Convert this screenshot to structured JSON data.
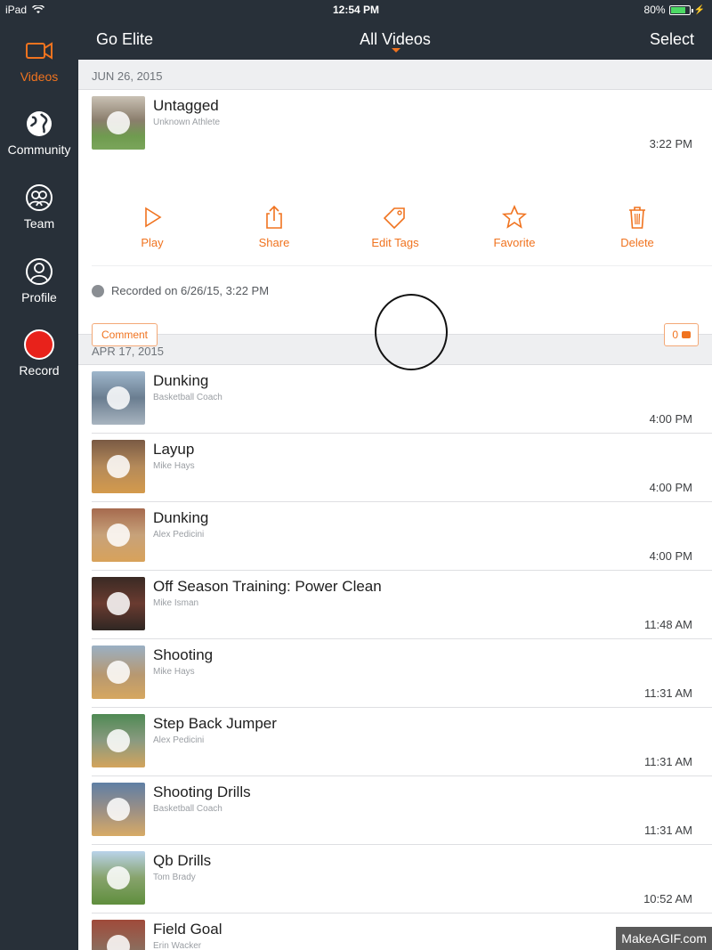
{
  "status_bar": {
    "carrier": "iPad",
    "time": "12:54 PM",
    "battery": "80%",
    "battery_level": 0.8
  },
  "sidebar": {
    "items": [
      {
        "label": "Videos",
        "icon": "video-camera-icon",
        "active": true
      },
      {
        "label": "Community",
        "icon": "globe-icon",
        "active": false
      },
      {
        "label": "Team",
        "icon": "team-icon",
        "active": false
      },
      {
        "label": "Profile",
        "icon": "profile-icon",
        "active": false
      },
      {
        "label": "Record",
        "icon": "record-icon",
        "active": false
      }
    ]
  },
  "navbar": {
    "left": "Go Elite",
    "title": "All Videos",
    "right": "Select"
  },
  "sections": [
    {
      "date": "JUN 26, 2015"
    },
    {
      "date": "APR 17, 2015"
    }
  ],
  "expanded_video": {
    "title": "Untagged",
    "subtitle": "Unknown Athlete",
    "time": "3:22 PM",
    "actions": [
      {
        "label": "Play",
        "icon": "play-icon"
      },
      {
        "label": "Share",
        "icon": "share-icon"
      },
      {
        "label": "Edit Tags",
        "icon": "tag-icon"
      },
      {
        "label": "Favorite",
        "icon": "star-icon"
      },
      {
        "label": "Delete",
        "icon": "trash-icon"
      }
    ],
    "recorded": "Recorded on 6/26/15, 3:22 PM",
    "comment_label": "Comment",
    "comment_count": "0"
  },
  "videos": [
    {
      "title": "Dunking",
      "subtitle": "Basketball Coach",
      "time": "4:00 PM"
    },
    {
      "title": "Layup",
      "subtitle": "Mike Hays",
      "time": "4:00 PM"
    },
    {
      "title": "Dunking",
      "subtitle": "Alex Pedicini",
      "time": "4:00 PM"
    },
    {
      "title": "Off Season Training: Power Clean",
      "subtitle": "Mike Isman",
      "time": "11:48 AM"
    },
    {
      "title": "Shooting",
      "subtitle": "Mike Hays",
      "time": "11:31 AM"
    },
    {
      "title": "Step Back Jumper",
      "subtitle": "Alex Pedicini",
      "time": "11:31 AM"
    },
    {
      "title": "Shooting Drills",
      "subtitle": "Basketball Coach",
      "time": "11:31 AM"
    },
    {
      "title": "Qb Drills",
      "subtitle": "Tom Brady",
      "time": "10:52 AM"
    },
    {
      "title": "Field Goal",
      "subtitle": "Erin Wacker",
      "time": ""
    }
  ],
  "watermark": "MakeAGIF.com",
  "colors": {
    "accent": "#f0731f",
    "dark": "#283039",
    "record": "#e8221b"
  }
}
